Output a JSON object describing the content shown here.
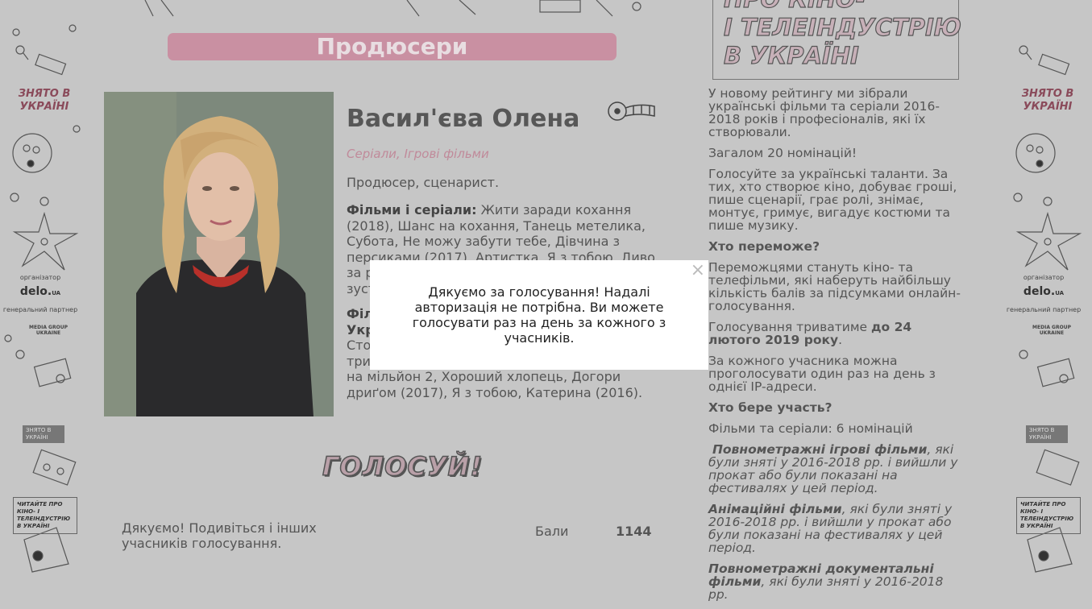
{
  "header": {
    "section_title": "Продюсери"
  },
  "person": {
    "name": "Васил'єва Олена",
    "categories": "Серіали, Ігрові фільми",
    "role": "Продюсер, сценарист.",
    "films_label": "Фільми і серіали:",
    "films_text": " Жити заради кохання (2018), Шанс на кохання, Танець метелика, Субота, Не можу забути тебе, Дівчина з персиками (2017), Артистка, Я з тобою, Диво за розкладом, Цен",
    "films_line2": "зуст",
    "films2_label_a": "Філ",
    "films2_label_b": "Укр",
    "films2_line1": "Сто",
    "films2_line2": "три",
    "films2_line3": "на мільйон 2, Хороший хлопець, Догори дриґом (2017), Я з тобою, Катерина (2016)."
  },
  "vote": {
    "button_label": "ГОЛОСУЙ!",
    "thanks_text": "Дякуємо! Подивіться і інших учасників голосування.",
    "score_label": "Бали",
    "score_value": "1144"
  },
  "sidebar_deco": {
    "znyato": "ЗНЯТО В УКРАЇНІ",
    "organizer": "організатор",
    "delo": "delo.",
    "delo_ua": "UA",
    "partner": "генеральний партнер",
    "mgu": "MEDIA GROUP UKRAINE",
    "badge": "ЗНЯТО В УКРАЇНІ",
    "read_box": "ЧИТАЙТЕ ПРО КІНО- І ТЕЛЕІНДУСТРІЮ В УКРАЇНІ"
  },
  "promo": {
    "title": "ПРО КІНО-\nІ ТЕЛЕІНДУСТРІЮ\nВ УКРАЇНІ"
  },
  "info": {
    "intro": "У новому рейтингу ми зібрали українські фільми та серіали 2016-2018 років і професіоналів, які їх створювали.",
    "total": "Загалом 20 номінацій!",
    "call": "Голосуйте за українські таланти. За тих, хто створює кіно, добуває гроші, пише сценарії, грає ролі, знімає, монтує, гримує, вигадує костюми та пише музику.",
    "who_wins_h": "Хто переможе?",
    "who_wins": "Переможцями стануть кіно- та телефільми, які наберуть найбільшу кількість балів за підсумками онлайн-голосування.",
    "duration_a": "Голосування триватиме ",
    "duration_b": "до 24 лютого 2019 року",
    "duration_c": ".",
    "per_ip": "За кожного учасника можна проголосувати один раз на день з однієї IP-адреси.",
    "who_part_h": "Хто бере участь?",
    "films_noms": "Фільми та серіали: 6 номінацій",
    "nom1_b": "Повнометражні ігрові фільми",
    "nom1_t": ", які були зняті у 2016-2018 рр. і вийшли у прокат або були показані на фестивалях у цей період.",
    "nom2_b": "Анімаційні фільми",
    "nom2_t": ", які були зняті у 2016-2018 рр. і вийшли у прокат або були показані на фестивалях у цей період.",
    "nom3_b": "Повнометражні документальні фільми",
    "nom3_t": ", які були зняті у 2016-2018 рр."
  },
  "modal": {
    "message": "Дякуємо за голосування! Надалі авторизація не потрібна. Ви можете голосувати раз на день за кожного з учасників.",
    "close_symbol": "×"
  }
}
